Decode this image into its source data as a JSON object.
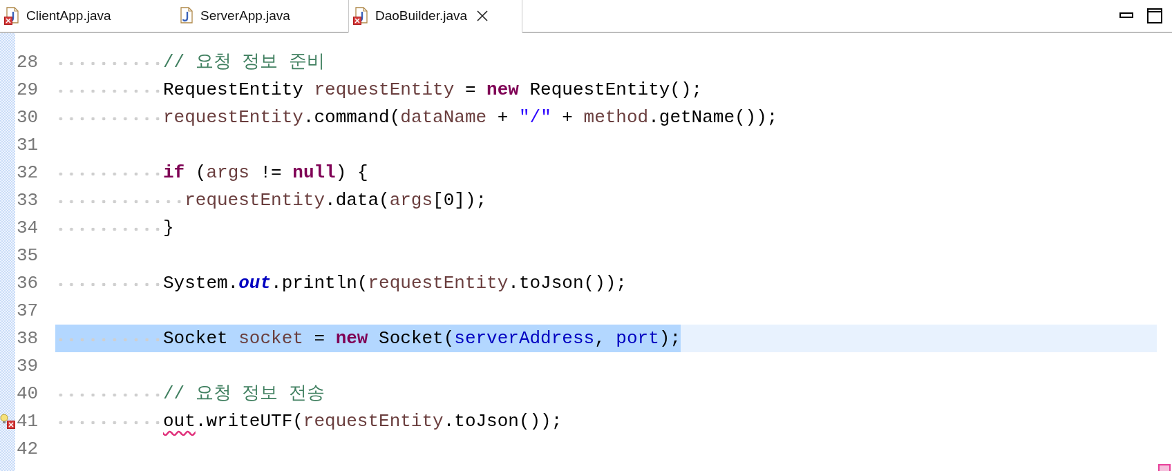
{
  "tabs": [
    {
      "label": "ClientApp.java",
      "selected": false,
      "error": true,
      "closable": false
    },
    {
      "label": "ServerApp.java",
      "selected": false,
      "error": false,
      "closable": false
    },
    {
      "label": "DaoBuilder.java",
      "selected": true,
      "error": true,
      "closable": true
    }
  ],
  "editor": {
    "lines": [
      {
        "number": "28",
        "selected": false,
        "nested": false,
        "tokens": [
          {
            "kind": "comment",
            "text": "// 요청 정보 준비"
          }
        ]
      },
      {
        "number": "29",
        "selected": false,
        "nested": false,
        "tokens": [
          {
            "kind": "plain",
            "text": "RequestEntity "
          },
          {
            "kind": "local",
            "text": "requestEntity"
          },
          {
            "kind": "plain",
            "text": " = "
          },
          {
            "kind": "keyword",
            "text": "new"
          },
          {
            "kind": "plain",
            "text": " RequestEntity();"
          }
        ]
      },
      {
        "number": "30",
        "selected": false,
        "nested": false,
        "tokens": [
          {
            "kind": "local",
            "text": "requestEntity"
          },
          {
            "kind": "plain",
            "text": ".command("
          },
          {
            "kind": "local",
            "text": "dataName"
          },
          {
            "kind": "plain",
            "text": " + "
          },
          {
            "kind": "string",
            "text": "\"/\""
          },
          {
            "kind": "plain",
            "text": " + "
          },
          {
            "kind": "local",
            "text": "method"
          },
          {
            "kind": "plain",
            "text": ".getName());"
          }
        ]
      },
      {
        "number": "31",
        "selected": false
      },
      {
        "number": "32",
        "selected": false,
        "nested": false,
        "tokens": [
          {
            "kind": "keyword",
            "text": "if"
          },
          {
            "kind": "plain",
            "text": " ("
          },
          {
            "kind": "local",
            "text": "args"
          },
          {
            "kind": "plain",
            "text": " != "
          },
          {
            "kind": "keyword",
            "text": "null"
          },
          {
            "kind": "plain",
            "text": ") {"
          }
        ]
      },
      {
        "number": "33",
        "selected": false,
        "nested": true,
        "tokens": [
          {
            "kind": "local",
            "text": "requestEntity"
          },
          {
            "kind": "plain",
            "text": ".data("
          },
          {
            "kind": "local",
            "text": "args"
          },
          {
            "kind": "plain",
            "text": "[0]);"
          }
        ]
      },
      {
        "number": "34",
        "selected": false,
        "nested": false,
        "tokens": [
          {
            "kind": "plain",
            "text": "}"
          }
        ]
      },
      {
        "number": "35",
        "selected": false
      },
      {
        "number": "36",
        "selected": false,
        "nested": false,
        "tokens": [
          {
            "kind": "plain",
            "text": "System."
          },
          {
            "kind": "static",
            "text": "out"
          },
          {
            "kind": "plain",
            "text": ".println("
          },
          {
            "kind": "local",
            "text": "requestEntity"
          },
          {
            "kind": "plain",
            "text": ".toJson());"
          }
        ]
      },
      {
        "number": "37",
        "selected": false
      },
      {
        "number": "38",
        "selected": true,
        "nested": false,
        "tokens": [
          {
            "kind": "plain",
            "text": "Socket "
          },
          {
            "kind": "local",
            "text": "socket"
          },
          {
            "kind": "plain",
            "text": " = "
          },
          {
            "kind": "keyword",
            "text": "new"
          },
          {
            "kind": "plain",
            "text": " Socket("
          },
          {
            "kind": "field",
            "text": "serverAddress"
          },
          {
            "kind": "plain",
            "text": ", "
          },
          {
            "kind": "field",
            "text": "port"
          },
          {
            "kind": "plain",
            "text": ");"
          }
        ]
      },
      {
        "number": "39",
        "selected": false
      },
      {
        "number": "40",
        "selected": false,
        "nested": false,
        "tokens": [
          {
            "kind": "comment",
            "text": "// 요청 정보 전송"
          }
        ]
      },
      {
        "number": "41",
        "selected": false,
        "nested": false,
        "quickfix_error": true,
        "tokens": [
          {
            "kind": "error",
            "text": "out"
          },
          {
            "kind": "plain",
            "text": ".writeUTF("
          },
          {
            "kind": "local",
            "text": "requestEntity"
          },
          {
            "kind": "plain",
            "text": ".toJson());"
          }
        ]
      },
      {
        "number": "42",
        "selected": false
      }
    ]
  }
}
